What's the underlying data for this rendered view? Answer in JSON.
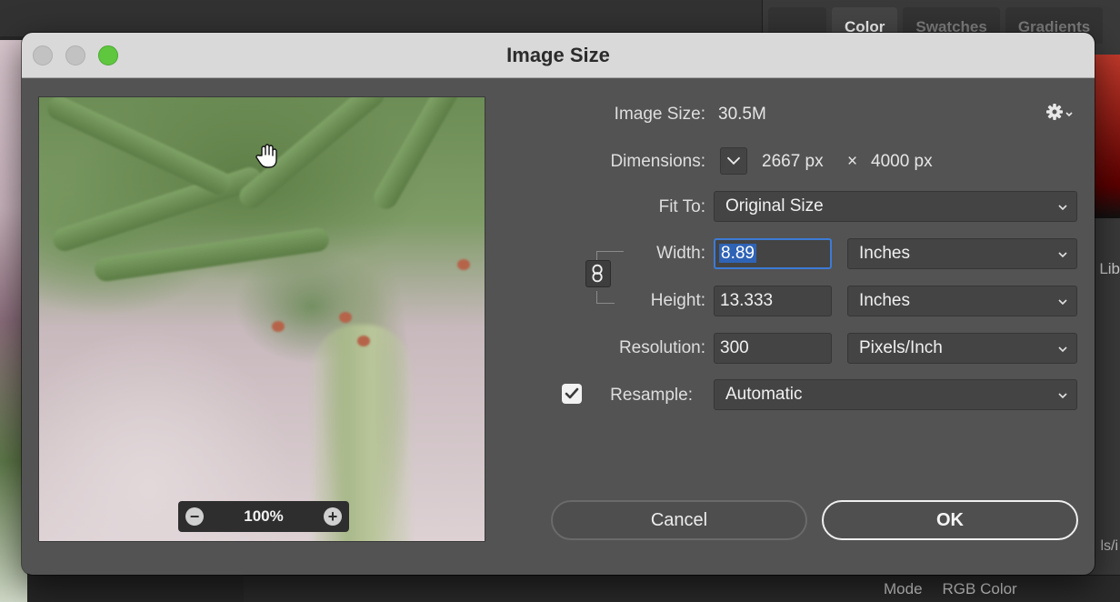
{
  "app": {
    "panel_tabs": [
      "Color",
      "Swatches",
      "Gradients"
    ],
    "panel_fragment_lib": "Lib",
    "panel_fragment_bottom": "ls/i",
    "mode_label": "Mode",
    "mode_value": "RGB Color"
  },
  "dialog": {
    "title": "Image Size",
    "image_size_label": "Image Size:",
    "image_size_value": "30.5M",
    "dimensions_label": "Dimensions:",
    "dimensions_width": "2667 px",
    "dimensions_times": "×",
    "dimensions_height": "4000 px",
    "fit_to_label": "Fit To:",
    "fit_to_value": "Original Size",
    "width_label": "Width:",
    "width_value": "8.89",
    "width_unit": "Inches",
    "height_label": "Height:",
    "height_value": "13.333",
    "height_unit": "Inches",
    "resolution_label": "Resolution:",
    "resolution_value": "300",
    "resolution_unit": "Pixels/Inch",
    "resample_label": "Resample:",
    "resample_value": "Automatic",
    "resample_checked": true,
    "zoom_value": "100%",
    "zoom_minus": "−",
    "zoom_plus": "+",
    "cancel_label": "Cancel",
    "ok_label": "OK"
  },
  "colors": {
    "dialog_bg": "#535353",
    "titlebar_bg": "#d9d9d9",
    "focus_ring": "#3d7bd6",
    "maximize_green": "#5fc73e"
  }
}
